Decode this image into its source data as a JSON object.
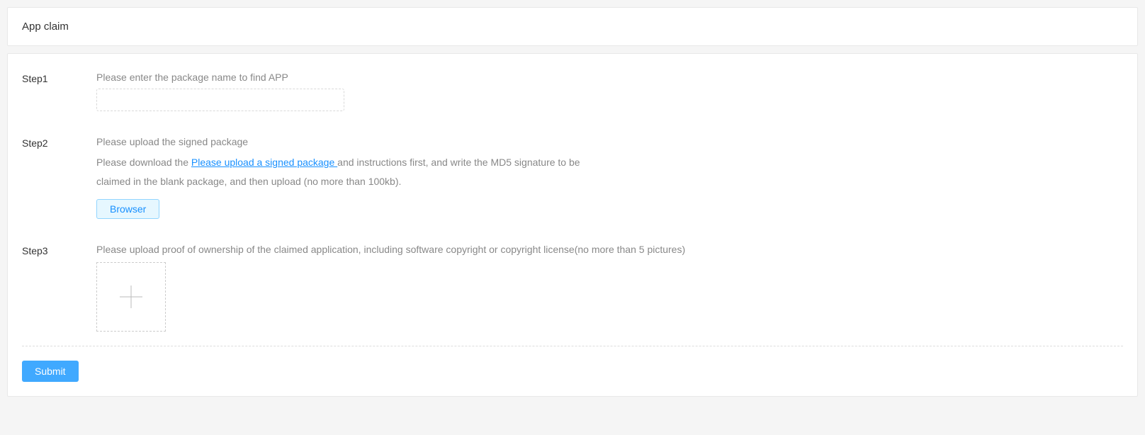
{
  "header": {
    "title": "App claim"
  },
  "steps": {
    "step1": {
      "label": "Step1",
      "instruction": "Please enter the package name to find APP",
      "input_value": ""
    },
    "step2": {
      "label": "Step2",
      "instruction": "Please upload the signed package",
      "desc_prefix": "Please download the ",
      "link_text": " Please upload a signed package ",
      "desc_suffix": "and instructions first, and write the MD5 signature to be claimed in the blank package, and then upload (no more than 100kb).",
      "browser_button": "Browser"
    },
    "step3": {
      "label": "Step3",
      "instruction": "Please upload proof of ownership of the claimed application, including software copyright or copyright license(no more than 5 pictures)"
    }
  },
  "actions": {
    "submit": "Submit"
  }
}
